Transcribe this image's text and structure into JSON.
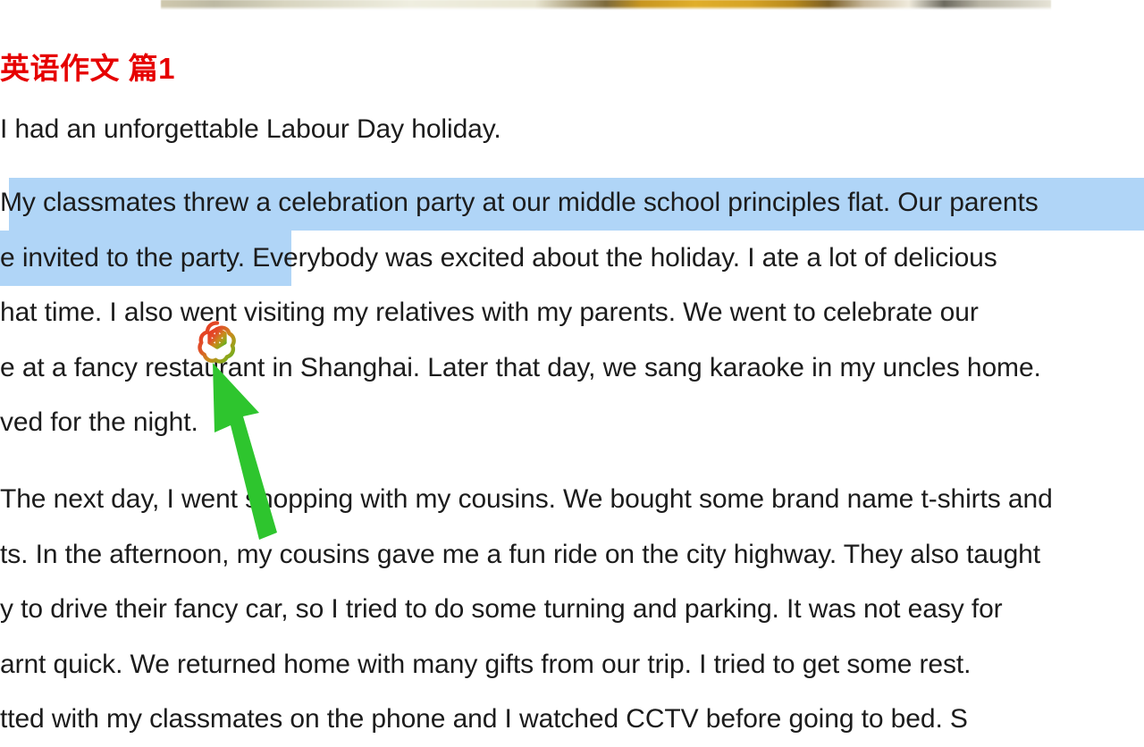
{
  "page": {
    "background_color": "#ffffff",
    "text_color": "#1c1c1c",
    "heading_color": "#e60000",
    "selection_color": "#b0d5f7",
    "arrow_color": "#2ec52e"
  },
  "top_banner": {
    "alt": "cropped photograph strip"
  },
  "heading": {
    "title_cn": "英语作文",
    "title_num": " 篇1",
    "full": "英语作文 篇1"
  },
  "essay": {
    "paragraphs": [
      {
        "id": "para-1",
        "lines": [
          "I had an unforgettable Labour Day holiday."
        ]
      },
      {
        "id": "para-2",
        "lines": [
          "My classmates threw a celebration party at our middle school principles flat. Our parents",
          "e invited to the party. Everybody was excited about the holiday. I ate a lot of delicious",
          "hat time. I also went visiting my relatives with my parents. We went to celebrate our",
          "e at a fancy restaurant in Shanghai. Later that day, we sang karaoke in my uncles home.",
          "ved for the night."
        ]
      },
      {
        "id": "para-3",
        "lines": [
          "The next day, I went shopping with my cousins. We bought some brand name t-shirts and",
          "ts. In the afternoon, my cousins gave me a fun ride on the city highway. They also taught",
          "y to drive their fancy car, so I tried to do some turning and parking. It was not easy for",
          "arnt quick. We returned home with many gifts from our trip. I tried to get some rest.",
          "tted with my classmates on the phone and I watched CCTV before going to bed. S"
        ]
      }
    ]
  },
  "selection": {
    "highlighted_text": "My classmates threw a celebration party at our middle school principles flat. Our parents were invited to the party."
  },
  "overlays": {
    "openai_logo_name": "openai-logo",
    "arrow_name": "green-pointer-arrow"
  }
}
